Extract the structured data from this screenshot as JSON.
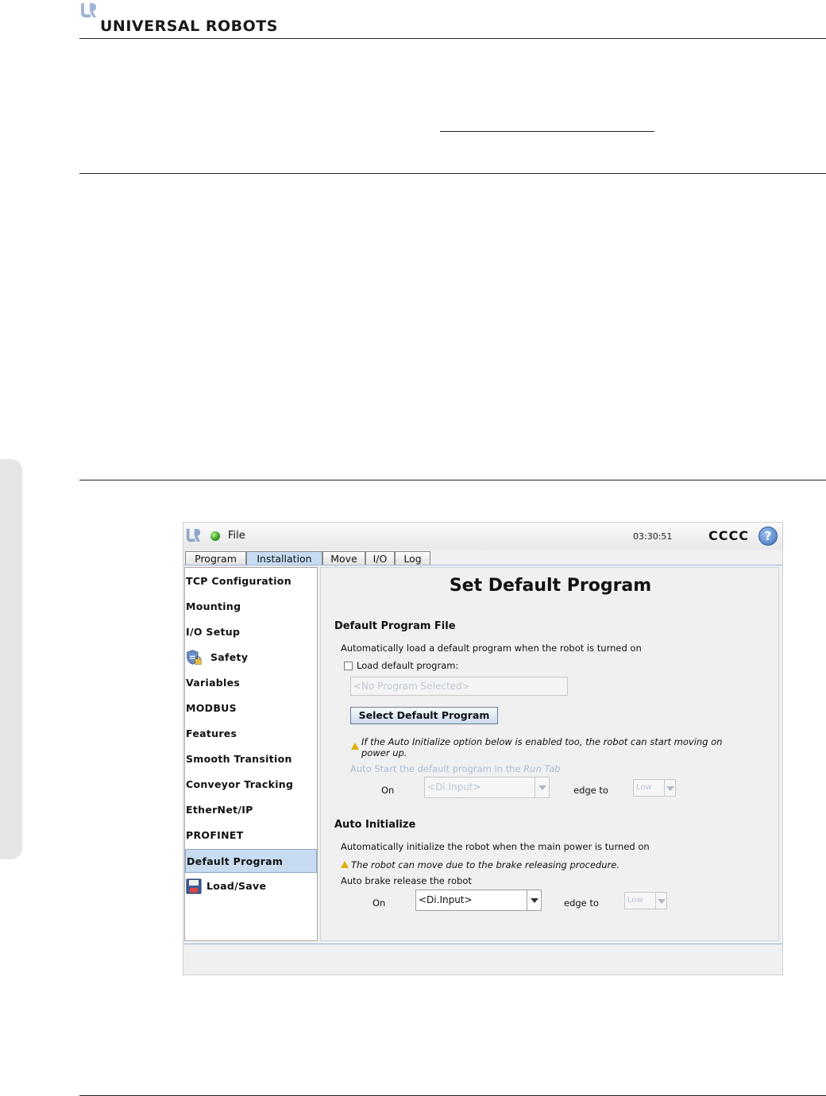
{
  "page": {
    "brand_name": "UNIVERSAL ROBOTS"
  },
  "app": {
    "menu_file": "File",
    "clock": "03:30:51",
    "robot_name": "CCCC",
    "help_glyph": "?"
  },
  "tabs": [
    {
      "label": "Program",
      "active": false
    },
    {
      "label": "Installation",
      "active": true
    },
    {
      "label": "Move",
      "active": false
    },
    {
      "label": "I/O",
      "active": false
    },
    {
      "label": "Log",
      "active": false
    }
  ],
  "sidebar": {
    "items": [
      {
        "label": "TCP Configuration"
      },
      {
        "label": "Mounting"
      },
      {
        "label": "I/O Setup"
      },
      {
        "label": "Safety",
        "icon": "safety-shield-lock-icon"
      },
      {
        "label": "Variables"
      },
      {
        "label": "MODBUS"
      },
      {
        "label": "Features"
      },
      {
        "label": "Smooth Transition"
      },
      {
        "label": "Conveyor Tracking"
      },
      {
        "label": "EtherNet/IP"
      },
      {
        "label": "PROFINET"
      },
      {
        "label": "Default Program",
        "selected": true
      },
      {
        "label": "Load/Save",
        "icon": "floppy-disk-icon"
      }
    ]
  },
  "main": {
    "title": "Set Default Program",
    "default_file": {
      "heading": "Default Program File",
      "description": "Automatically load a default program when the robot is turned on",
      "checkbox_label": "Load default program:",
      "program_field_placeholder": "<No Program Selected>",
      "select_button": "Select Default Program",
      "warning_line1": "If the Auto Initialize option below is enabled too, the robot can start moving on",
      "warning_line2": "power up.",
      "auto_start_label": "Auto Start the default program in the",
      "auto_start_tab": "Run Tab",
      "on_label": "On",
      "input_select": "<Di.Input>",
      "edge_label": "edge to",
      "level_select": "Low"
    },
    "auto_init": {
      "heading": "Auto Initialize",
      "description": "Automatically initialize the robot when the main power is turned on",
      "warning": "The robot can move due to the brake releasing procedure.",
      "brake_label": "Auto brake release the robot",
      "on_label": "On",
      "input_select": "<Di.Input>",
      "edge_label": "edge to",
      "level_select": "Low"
    }
  },
  "colors": {
    "selected_bg": "#c7dbf1",
    "disabled_text": "#a9bed6",
    "warning": "#e0b000"
  }
}
